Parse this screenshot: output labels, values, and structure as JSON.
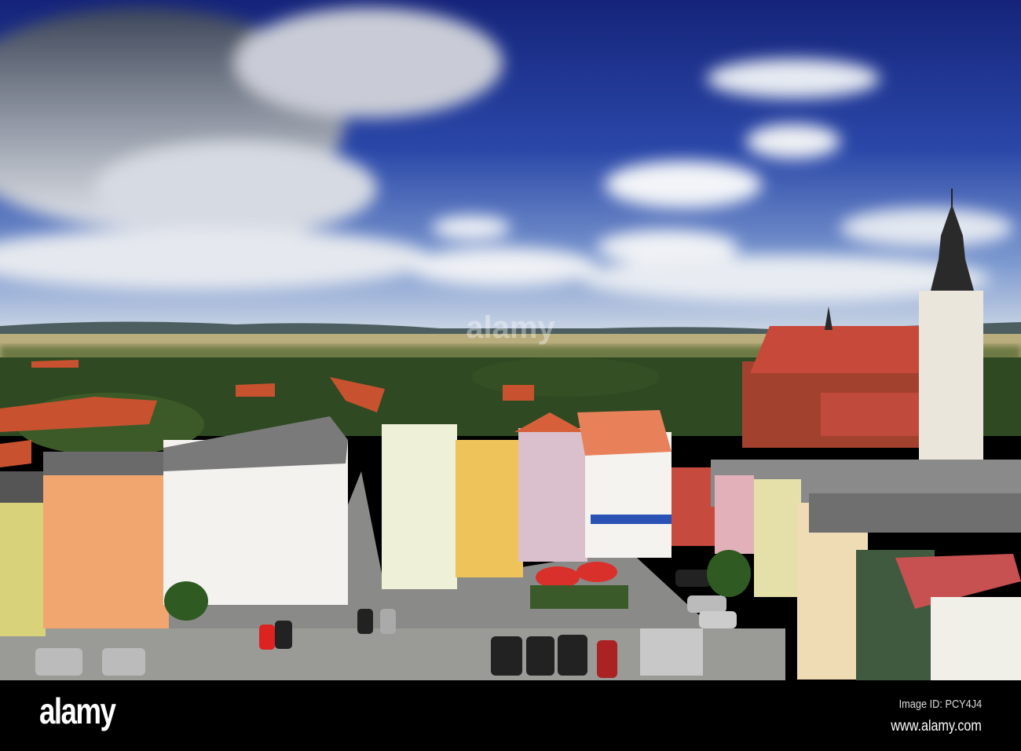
{
  "photo": {
    "subject": "town-square-aerial",
    "watermark": "alamy"
  },
  "footer": {
    "logo": "alamy",
    "image_id": "Image ID: PCY4J4",
    "url": "www.alamy.com"
  }
}
